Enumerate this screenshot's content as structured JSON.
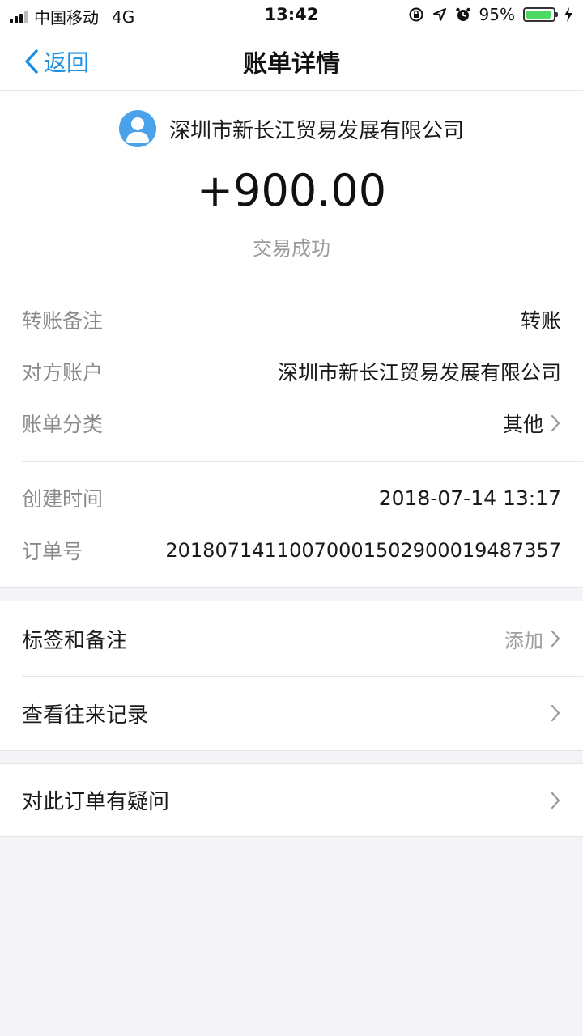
{
  "status_bar": {
    "carrier": "中国移动",
    "network": "4G",
    "time": "13:42",
    "battery_percent": "95%",
    "battery_level": 0.95
  },
  "nav": {
    "back_label": "返回",
    "title": "账单详情"
  },
  "transaction": {
    "merchant": "深圳市新长江贸易发展有限公司",
    "amount": "+900.00",
    "status": "交易成功"
  },
  "details": [
    {
      "label": "转账备注",
      "value": "转账"
    },
    {
      "label": "对方账户",
      "value": "深圳市新长江贸易发展有限公司"
    },
    {
      "label": "账单分类",
      "value": "其他"
    },
    {
      "label": "创建时间",
      "value": "2018-07-14 13:17"
    },
    {
      "label": "订单号",
      "value": "20180714110070001502900019487357"
    }
  ],
  "actions": {
    "tags_label": "标签和备注",
    "tags_value": "添加",
    "history_label": "查看往来记录",
    "question_label": "对此订单有疑问"
  },
  "colors": {
    "accent": "#1a8fe3",
    "battery": "#4cd964",
    "avatar": "#4aa3ea"
  },
  "icons": {
    "back": "chevron-left-icon",
    "avatar": "user-icon",
    "chevron": "chevron-right-icon"
  }
}
